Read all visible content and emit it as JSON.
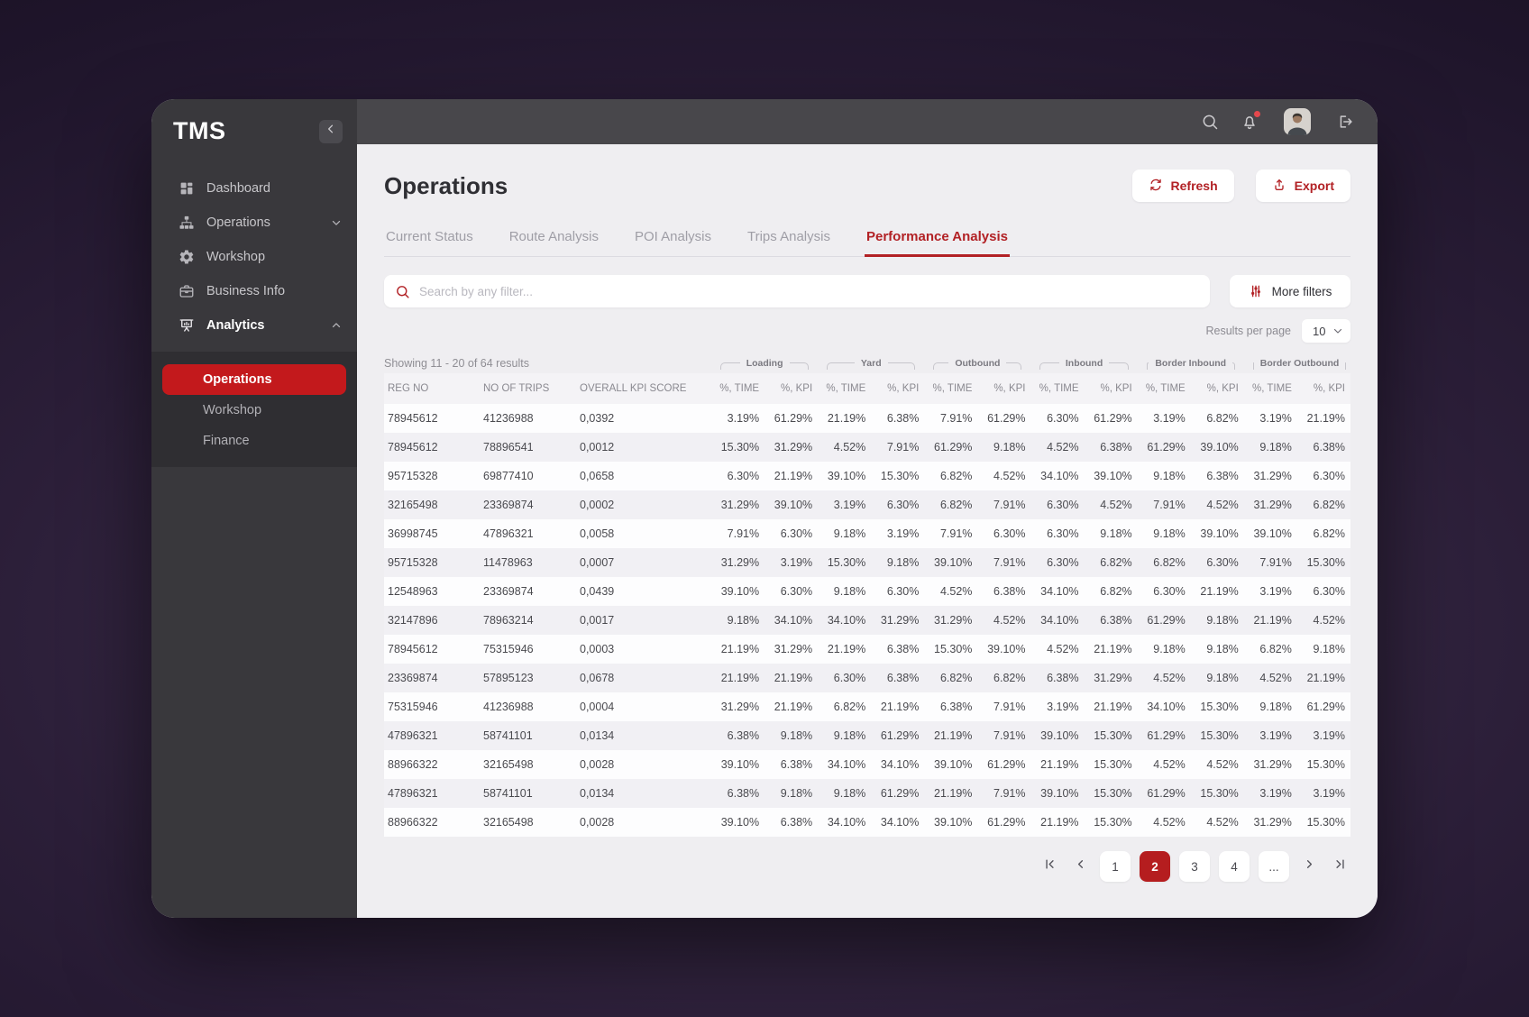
{
  "app": {
    "logo": "TMS"
  },
  "sidebar": {
    "items": [
      {
        "label": "Dashboard",
        "icon": "dashboard"
      },
      {
        "label": "Operations",
        "icon": "sitemap",
        "chevron": "down"
      },
      {
        "label": "Workshop",
        "icon": "gear"
      },
      {
        "label": "Business Info",
        "icon": "briefcase"
      },
      {
        "label": "Analytics",
        "icon": "presentation",
        "chevron": "up",
        "active": true
      }
    ],
    "submenu": [
      {
        "label": "Operations",
        "active": true
      },
      {
        "label": "Workshop"
      },
      {
        "label": "Finance"
      }
    ]
  },
  "header": {
    "title": "Operations",
    "refresh": "Refresh",
    "export": "Export"
  },
  "tabs": [
    {
      "label": "Current Status"
    },
    {
      "label": "Route Analysis"
    },
    {
      "label": "POI Analysis"
    },
    {
      "label": "Trips Analysis"
    },
    {
      "label": "Performance Analysis",
      "active": true
    }
  ],
  "filters": {
    "search_placeholder": "Search by any filter...",
    "more_filters": "More filters",
    "results_per_page_label": "Results per page",
    "results_per_page_value": "10"
  },
  "table": {
    "showing": "Showing 11 - 20 of 64 results",
    "groups": [
      "Loading",
      "Yard",
      "Outbound",
      "Inbound",
      "Border Inbound",
      "Border Outbound"
    ],
    "fixed_columns": [
      "REG NO",
      "NO OF TRIPS",
      "OVERALL KPI SCORE"
    ],
    "metric_columns": [
      "%, TIME",
      "%, KPI"
    ],
    "rows": [
      [
        "78945612",
        "41236988",
        "0,0392",
        "3.19%",
        "61.29%",
        "21.19%",
        "6.38%",
        "7.91%",
        "61.29%",
        "6.30%",
        "61.29%",
        "3.19%",
        "6.82%",
        "3.19%",
        "21.19%"
      ],
      [
        "78945612",
        "78896541",
        "0,0012",
        "15.30%",
        "31.29%",
        "4.52%",
        "7.91%",
        "61.29%",
        "9.18%",
        "4.52%",
        "6.38%",
        "61.29%",
        "39.10%",
        "9.18%",
        "6.38%"
      ],
      [
        "95715328",
        "69877410",
        "0,0658",
        "6.30%",
        "21.19%",
        "39.10%",
        "15.30%",
        "6.82%",
        "4.52%",
        "34.10%",
        "39.10%",
        "9.18%",
        "6.38%",
        "31.29%",
        "6.30%"
      ],
      [
        "32165498",
        "23369874",
        "0,0002",
        "31.29%",
        "39.10%",
        "3.19%",
        "6.30%",
        "6.82%",
        "7.91%",
        "6.30%",
        "4.52%",
        "7.91%",
        "4.52%",
        "31.29%",
        "6.82%"
      ],
      [
        "36998745",
        "47896321",
        "0,0058",
        "7.91%",
        "6.30%",
        "9.18%",
        "3.19%",
        "7.91%",
        "6.30%",
        "6.30%",
        "9.18%",
        "9.18%",
        "39.10%",
        "39.10%",
        "6.82%"
      ],
      [
        "95715328",
        "11478963",
        "0,0007",
        "31.29%",
        "3.19%",
        "15.30%",
        "9.18%",
        "39.10%",
        "7.91%",
        "6.30%",
        "6.82%",
        "6.82%",
        "6.30%",
        "7.91%",
        "15.30%"
      ],
      [
        "12548963",
        "23369874",
        "0,0439",
        "39.10%",
        "6.30%",
        "9.18%",
        "6.30%",
        "4.52%",
        "6.38%",
        "34.10%",
        "6.82%",
        "6.30%",
        "21.19%",
        "3.19%",
        "6.30%"
      ],
      [
        "32147896",
        "78963214",
        "0,0017",
        "9.18%",
        "34.10%",
        "34.10%",
        "31.29%",
        "31.29%",
        "4.52%",
        "34.10%",
        "6.38%",
        "61.29%",
        "9.18%",
        "21.19%",
        "4.52%"
      ],
      [
        "78945612",
        "75315946",
        "0,0003",
        "21.19%",
        "31.29%",
        "21.19%",
        "6.38%",
        "15.30%",
        "39.10%",
        "4.52%",
        "21.19%",
        "9.18%",
        "9.18%",
        "6.82%",
        "9.18%"
      ],
      [
        "23369874",
        "57895123",
        "0,0678",
        "21.19%",
        "21.19%",
        "6.30%",
        "6.38%",
        "6.82%",
        "6.82%",
        "6.38%",
        "31.29%",
        "4.52%",
        "9.18%",
        "4.52%",
        "21.19%"
      ],
      [
        "75315946",
        "41236988",
        "0,0004",
        "31.29%",
        "21.19%",
        "6.82%",
        "21.19%",
        "6.38%",
        "7.91%",
        "3.19%",
        "21.19%",
        "34.10%",
        "15.30%",
        "9.18%",
        "61.29%"
      ],
      [
        "47896321",
        "58741101",
        "0,0134",
        "6.38%",
        "9.18%",
        "9.18%",
        "61.29%",
        "21.19%",
        "7.91%",
        "39.10%",
        "15.30%",
        "61.29%",
        "15.30%",
        "3.19%",
        "3.19%"
      ],
      [
        "88966322",
        "32165498",
        "0,0028",
        "39.10%",
        "6.38%",
        "34.10%",
        "34.10%",
        "39.10%",
        "61.29%",
        "21.19%",
        "15.30%",
        "4.52%",
        "4.52%",
        "31.29%",
        "15.30%"
      ],
      [
        "47896321",
        "58741101",
        "0,0134",
        "6.38%",
        "9.18%",
        "9.18%",
        "61.29%",
        "21.19%",
        "7.91%",
        "39.10%",
        "15.30%",
        "61.29%",
        "15.30%",
        "3.19%",
        "3.19%"
      ],
      [
        "88966322",
        "32165498",
        "0,0028",
        "39.10%",
        "6.38%",
        "34.10%",
        "34.10%",
        "39.10%",
        "61.29%",
        "21.19%",
        "15.30%",
        "4.52%",
        "4.52%",
        "31.29%",
        "15.30%"
      ]
    ]
  },
  "pagination": {
    "pages": [
      "1",
      "2",
      "3",
      "4"
    ],
    "active_page": "2",
    "ellipsis": "..."
  },
  "colors": {
    "accent_red": "#b22125",
    "active_pill_red": "#c3191c",
    "notification_dot": "#e5484d"
  }
}
